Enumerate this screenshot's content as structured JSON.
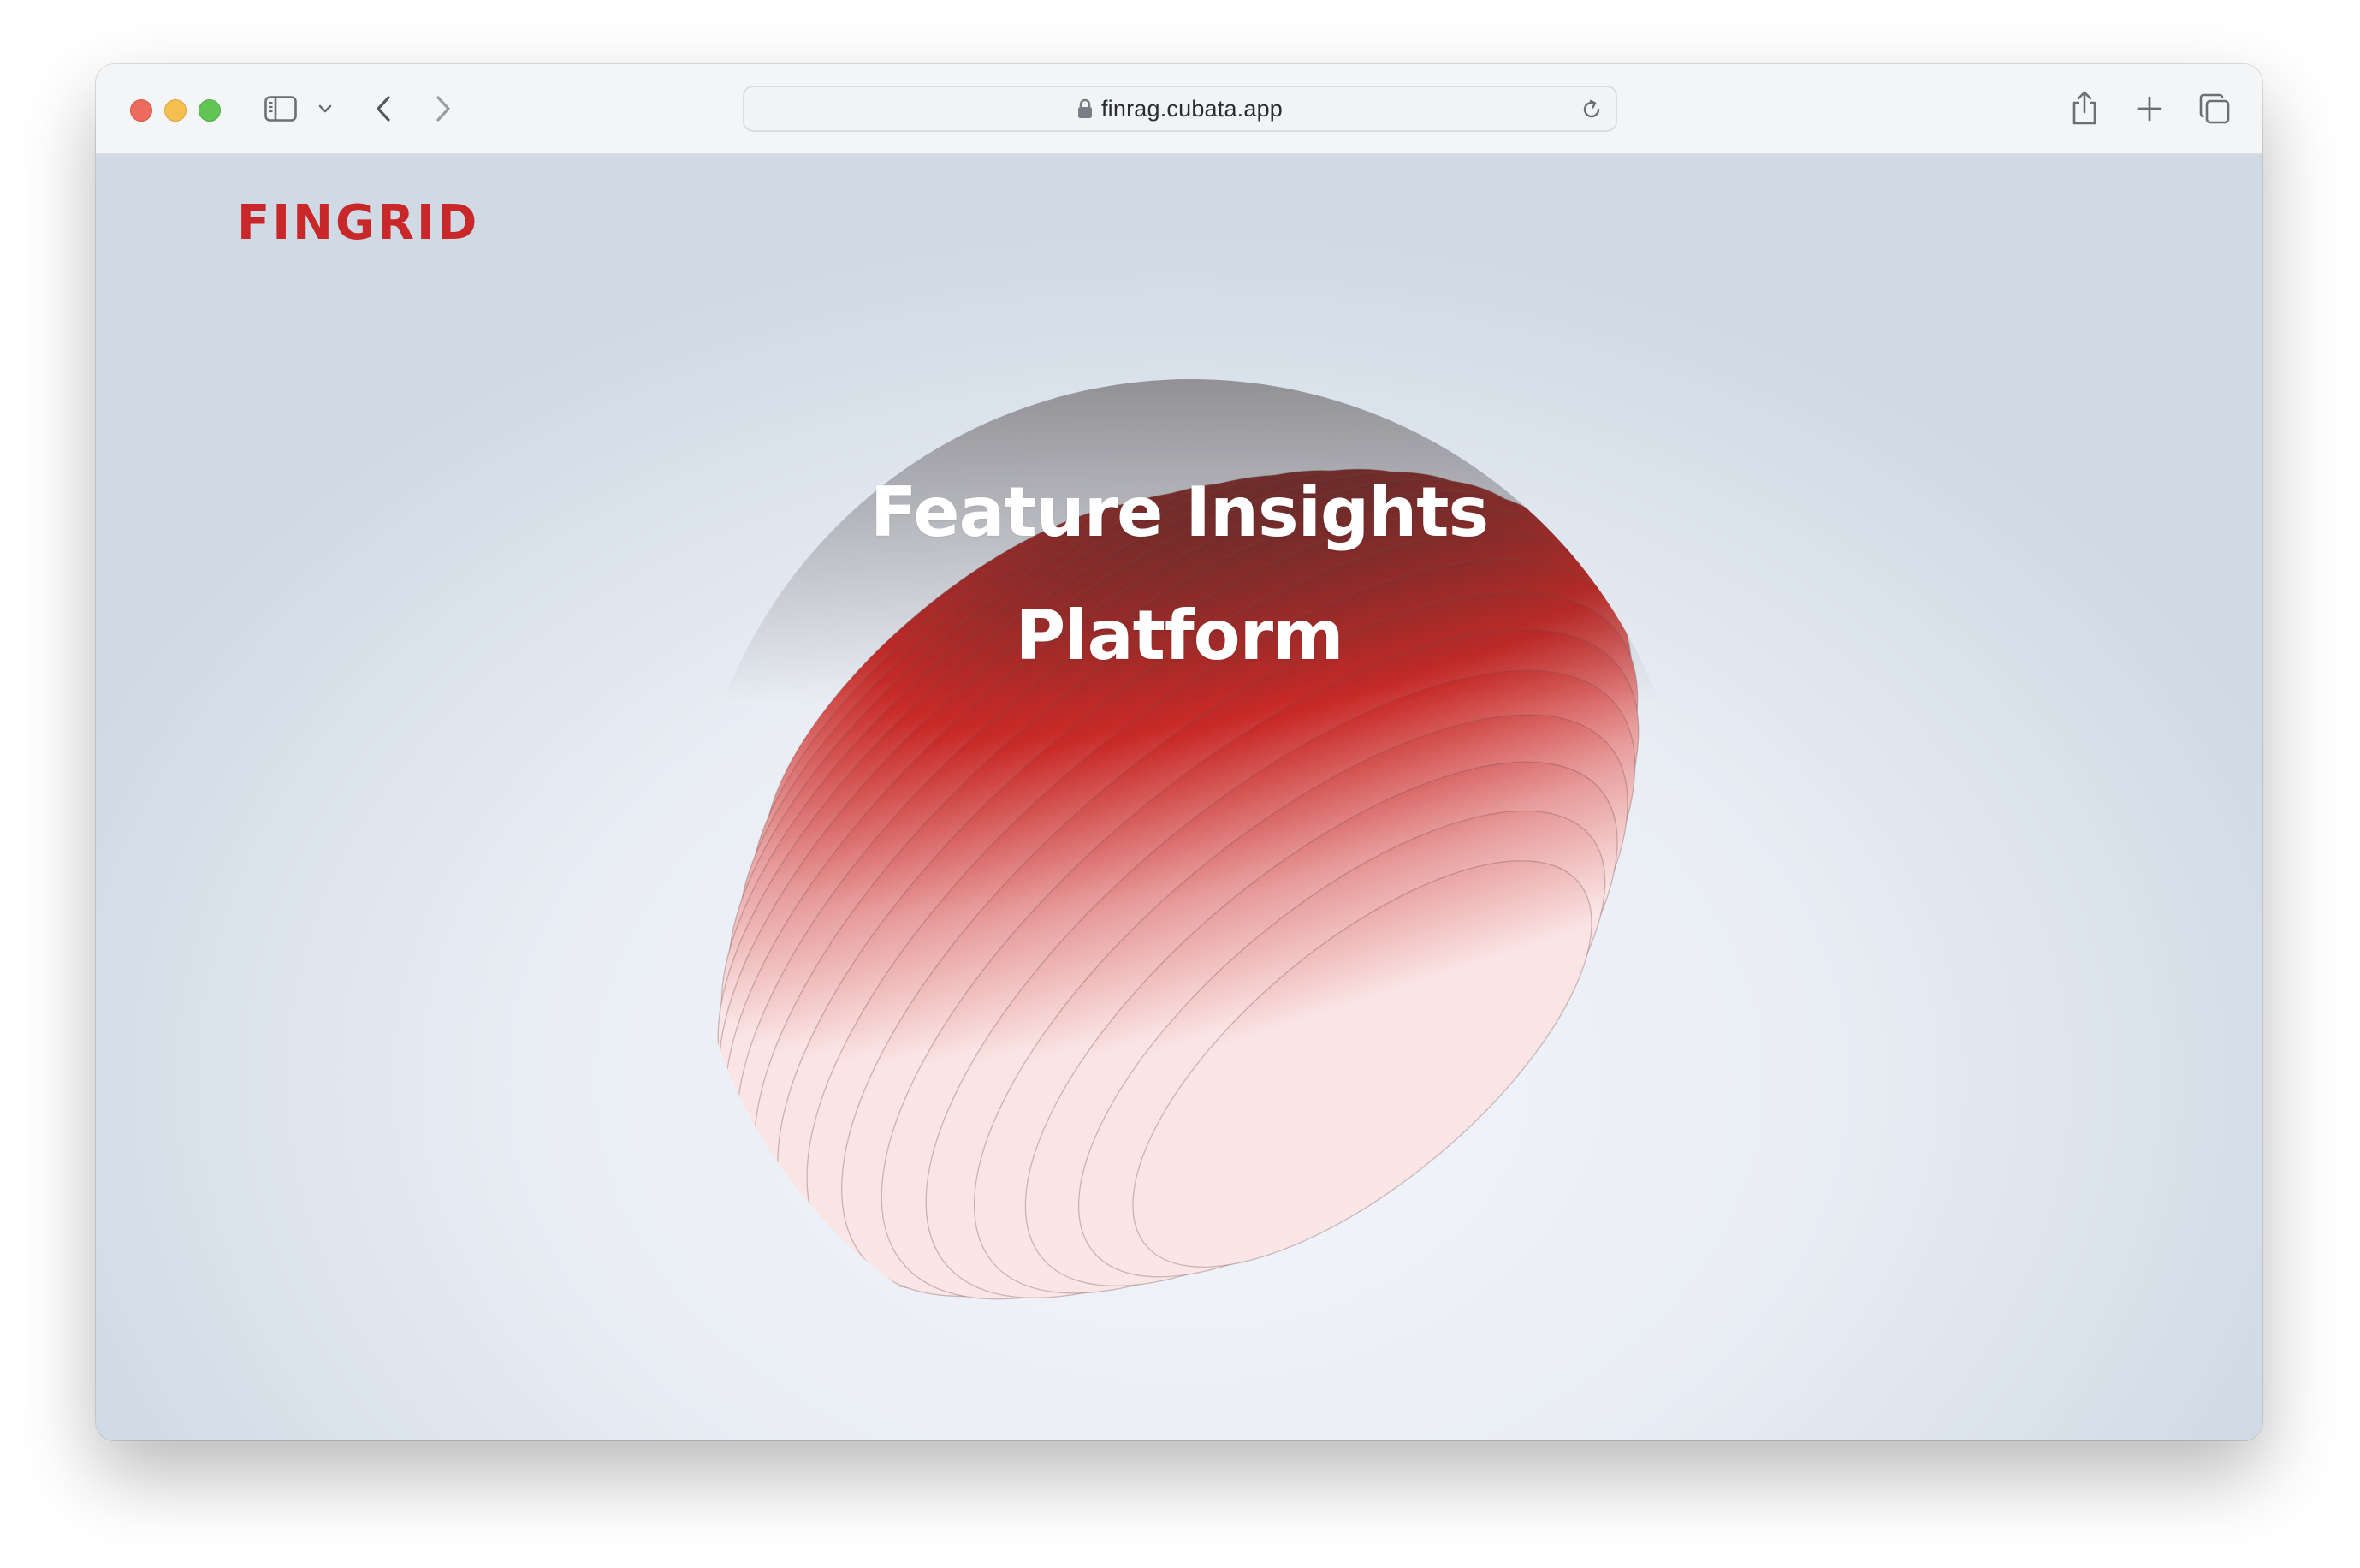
{
  "browser": {
    "url": "finrag.cubata.app",
    "icons": {
      "sidebar": "sidebar-icon",
      "chevron": "chevron-down-icon",
      "back": "back-arrow-icon",
      "forward": "forward-arrow-icon",
      "lock": "lock-icon",
      "reload": "reload-icon",
      "share": "share-icon",
      "new_tab": "plus-icon",
      "tabs": "tab-overview-icon"
    }
  },
  "page": {
    "logo": "FINGRID",
    "hero_line1": "Feature Insights",
    "hero_line2": "Platform"
  },
  "colors": {
    "brand_red": "#c8282a",
    "sphere_dark": "#3b2f2e",
    "sphere_light": "#fbe6e6"
  }
}
